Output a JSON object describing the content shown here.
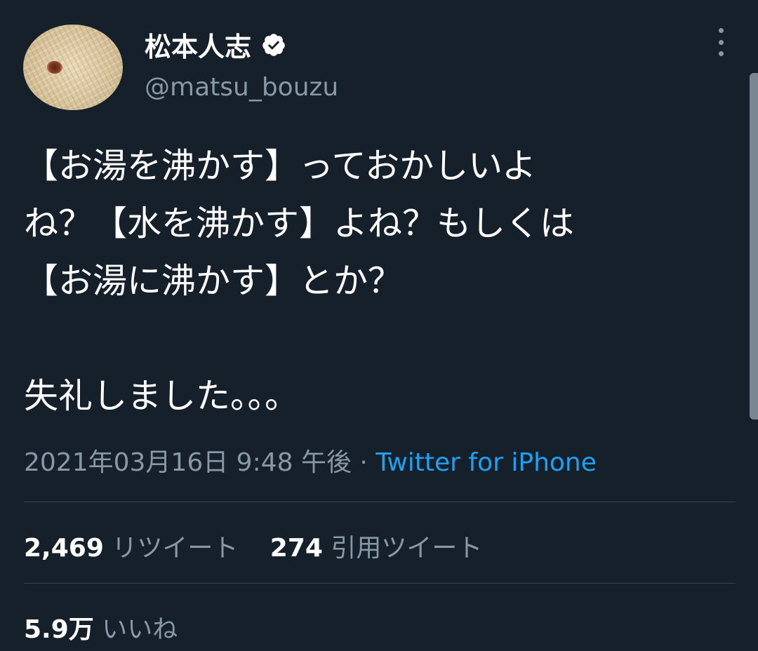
{
  "profile": {
    "display_name": "松本人志",
    "handle": "@matsu_bouzu"
  },
  "tweet": {
    "text": "【お湯を沸かす】っておかしいよ\nね？【水を沸かす】よね？もしくは\n【お湯に沸かす】とか？\n\n失礼しました。。。",
    "timestamp": "2021年03月16日 9:48 午後",
    "separator": " · ",
    "source": "Twitter for iPhone"
  },
  "stats": {
    "retweets_count": "2,469",
    "retweets_label": "リツイート",
    "quotes_count": "274",
    "quotes_label": "引用ツイート",
    "likes_count": "5.9万",
    "likes_label": "いいね"
  },
  "colors": {
    "background": "#15202b",
    "accent": "#1da1f2",
    "muted": "#8899a6"
  },
  "icons": [
    "verified-badge-icon",
    "more-options-icon"
  ]
}
